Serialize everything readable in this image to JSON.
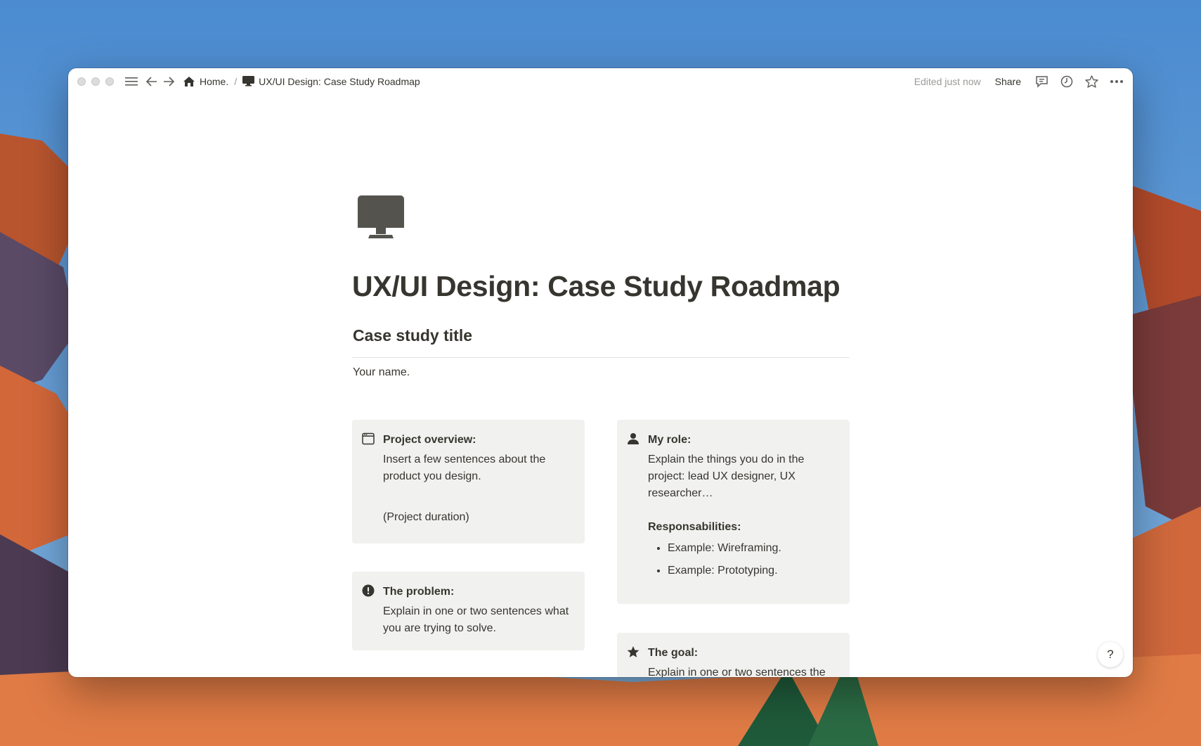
{
  "topbar": {
    "breadcrumb_home": "Home.",
    "breadcrumb_separator": "/",
    "breadcrumb_page": "UX/UI Design: Case Study Roadmap",
    "edited_status": "Edited just now",
    "share_label": "Share"
  },
  "page": {
    "icon": "desktop-computer-icon",
    "title": "UX/UI Design: Case Study Roadmap",
    "heading": "Case study title",
    "subtitle_line": "Your name."
  },
  "callouts": {
    "overview": {
      "icon": "browser-window-icon",
      "title": "Project overview:",
      "body": "Insert a few sentences about the product you design.",
      "extra": "(Project duration)"
    },
    "problem": {
      "icon": "exclamation-circle-icon",
      "title": "The problem:",
      "body": "Explain in one or two sentences what you are trying to solve."
    },
    "role": {
      "icon": "person-icon",
      "title": "My role:",
      "body": "Explain the things you do in the project: lead UX designer, UX researcher…",
      "subheading": "Responsabilities:",
      "items": [
        "Example: Wireframing.",
        "Example: Prototyping."
      ]
    },
    "goal": {
      "icon": "star-icon",
      "title": "The goal:",
      "body": "Explain in one or two sentences the goal of the project."
    }
  },
  "help_label": "?",
  "colors": {
    "text": "#37352f",
    "callout_bg": "#f1f1ef",
    "muted": "#9b9a97"
  }
}
